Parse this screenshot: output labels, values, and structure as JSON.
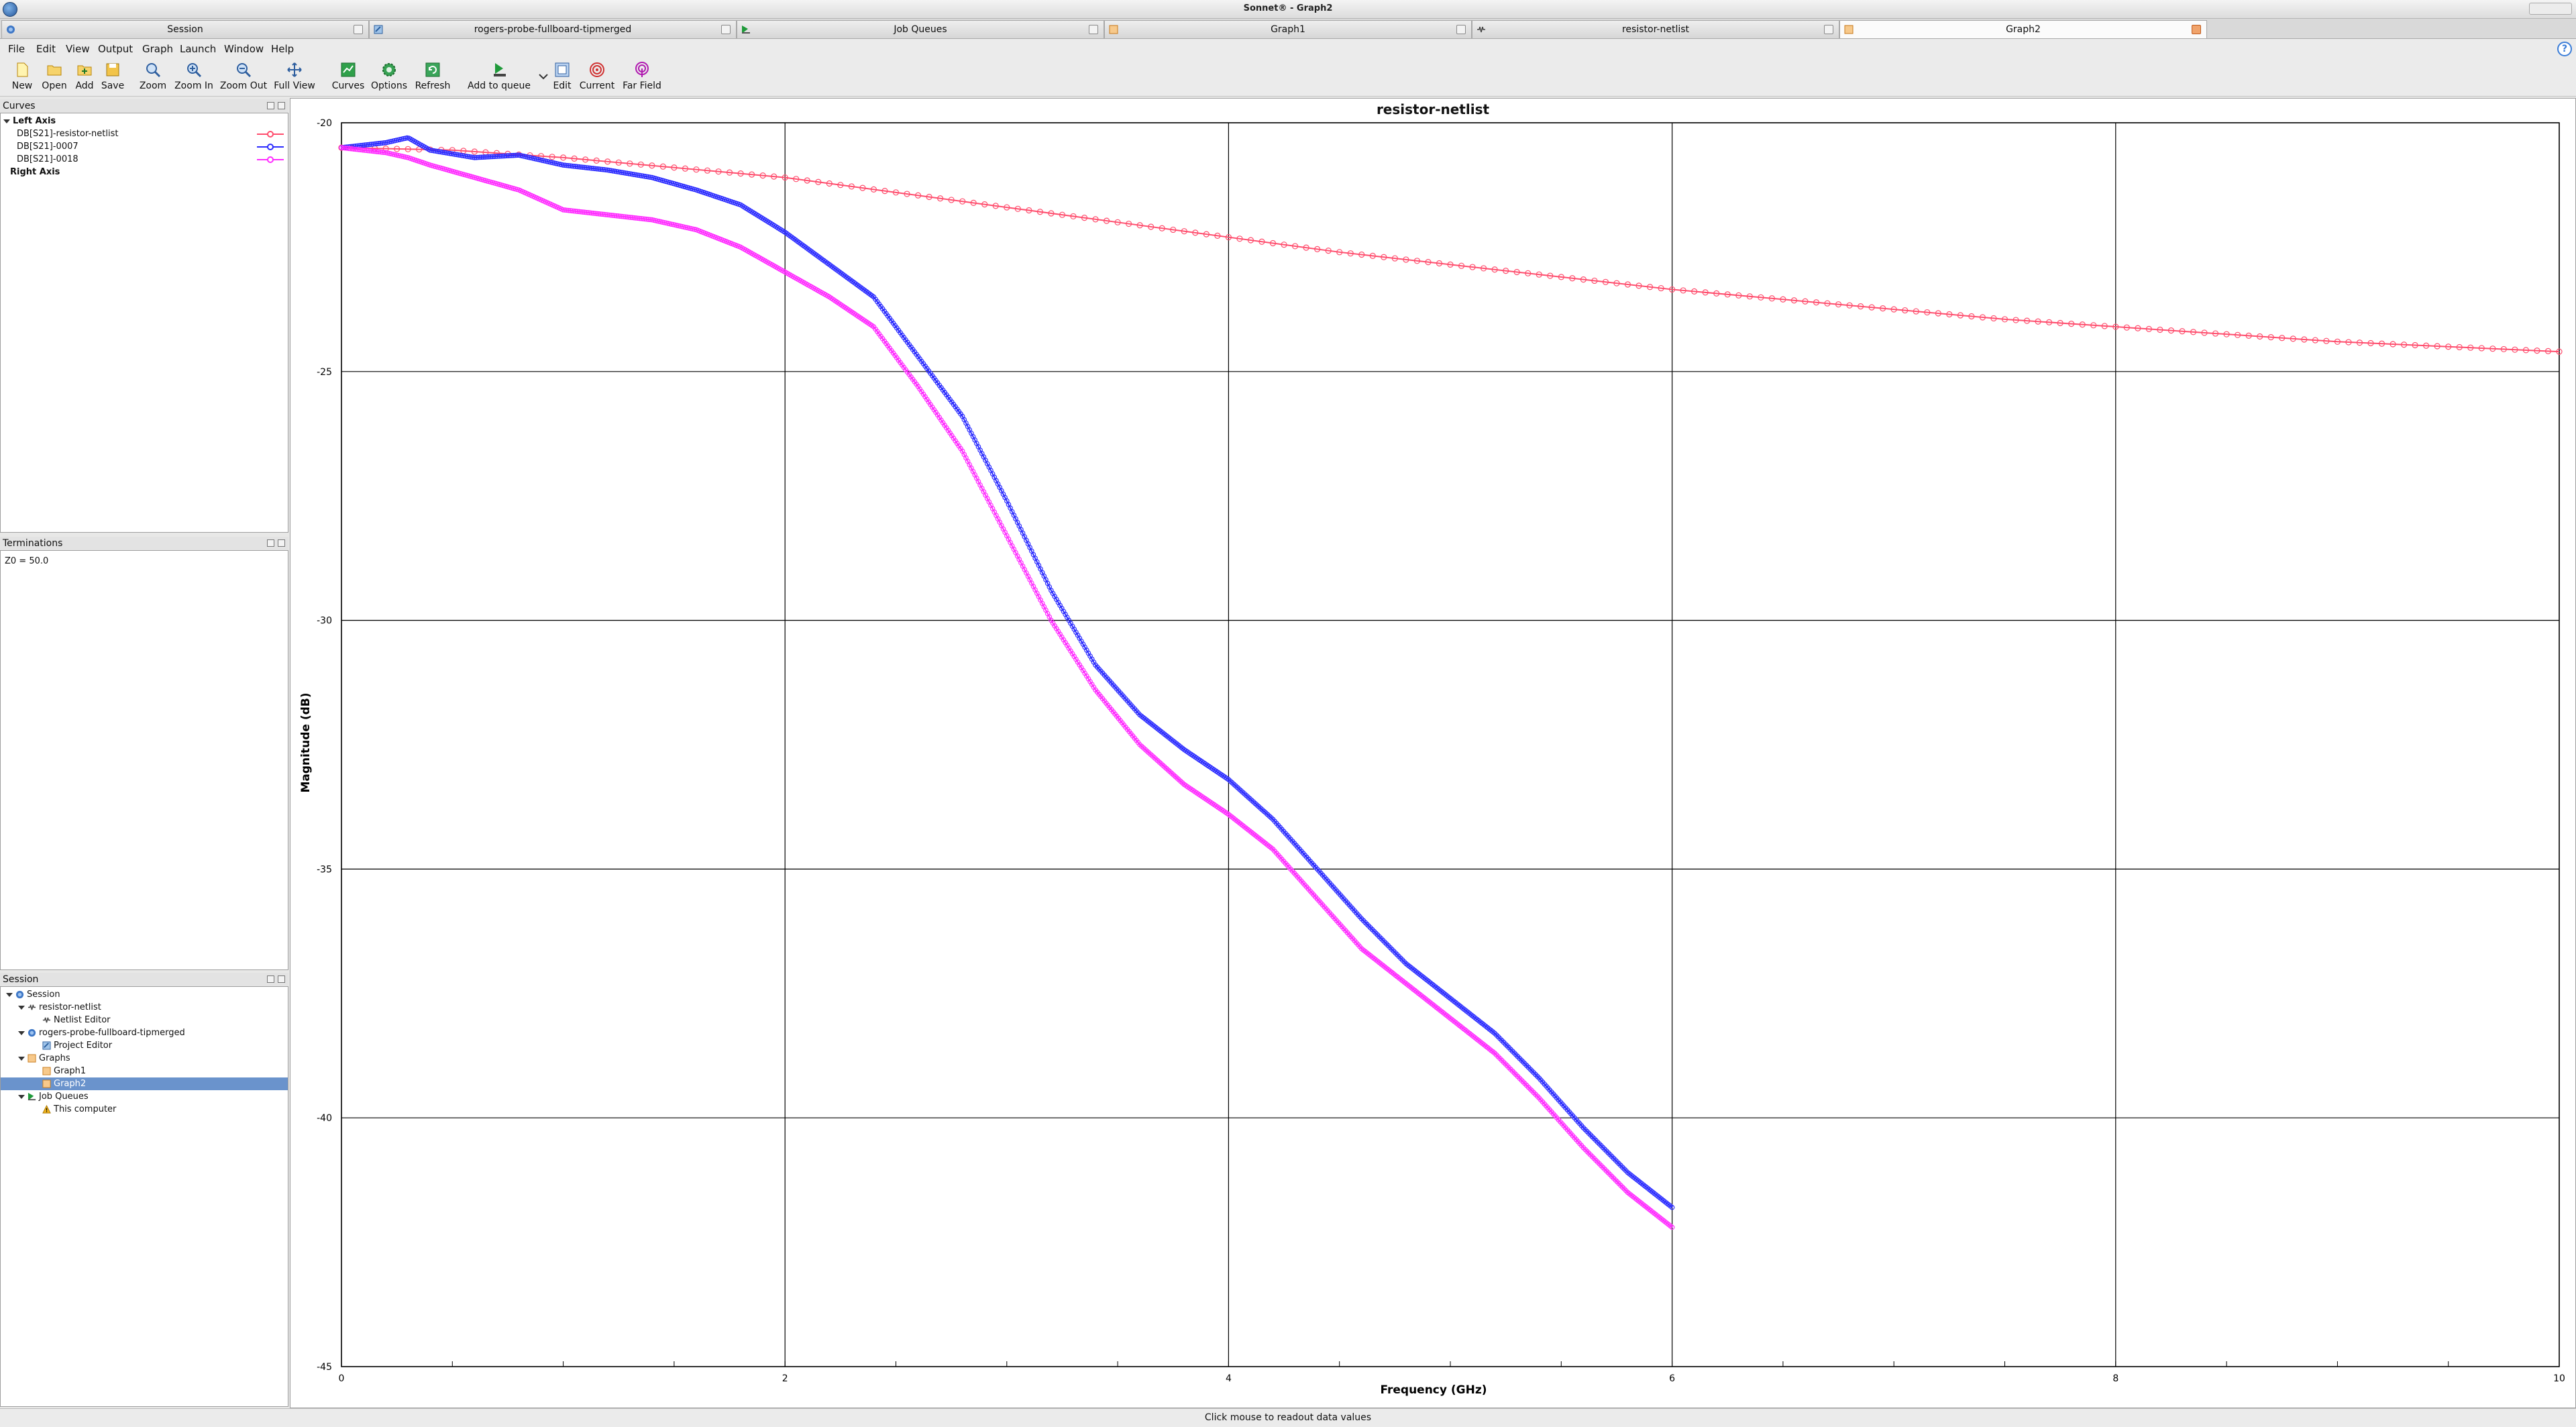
{
  "window": {
    "title": "Sonnet® - Graph2"
  },
  "doc_tabs": [
    {
      "label": "Session",
      "active": false
    },
    {
      "label": "rogers-probe-fullboard-tipmerged",
      "active": false
    },
    {
      "label": "Job Queues",
      "active": false
    },
    {
      "label": "Graph1",
      "active": false
    },
    {
      "label": "resistor-netlist",
      "active": false
    },
    {
      "label": "Graph2",
      "active": true
    }
  ],
  "menu": {
    "file": "File",
    "edit": "Edit",
    "view": "View",
    "output": "Output",
    "graph": "Graph",
    "launch": "Launch",
    "window": "Window",
    "help": "Help"
  },
  "toolbar": {
    "new": "New",
    "open": "Open",
    "add": "Add",
    "save": "Save",
    "zoom": "Zoom",
    "zoom_in": "Zoom In",
    "zoom_out": "Zoom Out",
    "full_view": "Full View",
    "curves": "Curves",
    "options": "Options",
    "refresh": "Refresh",
    "add_to_queue": "Add to queue",
    "edit": "Edit",
    "current": "Current",
    "far_field": "Far Field"
  },
  "curves_panel": {
    "title": "Curves",
    "left_axis": "Left Axis",
    "right_axis": "Right Axis",
    "items": [
      {
        "label": "DB[S21]-resistor-netlist",
        "color": "#ff4d6d"
      },
      {
        "label": "DB[S21]-0007",
        "color": "#2b2bff"
      },
      {
        "label": "DB[S21]-0018",
        "color": "#ff2bff"
      }
    ]
  },
  "terminations_panel": {
    "title": "Terminations",
    "text": "Z0 = 50.0"
  },
  "session_panel": {
    "title": "Session",
    "root": "Session",
    "resistor": "resistor-netlist",
    "netlist_editor": "Netlist Editor",
    "rogers": "rogers-probe-fullboard-tipmerged",
    "project_editor": "Project Editor",
    "graphs": "Graphs",
    "graph1": "Graph1",
    "graph2": "Graph2",
    "job_queues": "Job Queues",
    "this_computer": "This computer"
  },
  "status": {
    "text": "Click mouse to readout data values"
  },
  "chart_data": {
    "type": "line",
    "title": "resistor-netlist",
    "xlabel": "Frequency (GHz)",
    "ylabel": "Magnitude (dB)",
    "xlim": [
      0,
      10
    ],
    "ylim": [
      -45,
      -20
    ],
    "xticks": [
      0,
      2,
      4,
      6,
      8,
      10
    ],
    "yticks": [
      -20,
      -25,
      -30,
      -35,
      -40,
      -45
    ],
    "grid": true,
    "series": [
      {
        "name": "DB[S21]-resistor-netlist",
        "color": "#ff4d6d",
        "x": [
          0,
          0.5,
          1,
          1.5,
          2,
          2.5,
          3,
          3.5,
          4,
          4.5,
          5,
          5.5,
          6,
          6.5,
          7,
          7.5,
          8,
          8.5,
          9,
          9.5,
          10
        ],
        "y": [
          -20.5,
          -20.55,
          -20.7,
          -20.9,
          -21.1,
          -21.4,
          -21.7,
          -22.0,
          -22.3,
          -22.6,
          -22.85,
          -23.1,
          -23.35,
          -23.55,
          -23.75,
          -23.95,
          -24.1,
          -24.25,
          -24.4,
          -24.5,
          -24.6
        ]
      },
      {
        "name": "DB[S21]-0007",
        "color": "#2b2bff",
        "x": [
          0,
          0.1,
          0.2,
          0.3,
          0.4,
          0.6,
          0.8,
          1.0,
          1.2,
          1.4,
          1.6,
          1.8,
          2.0,
          2.2,
          2.4,
          2.6,
          2.8,
          3.0,
          3.2,
          3.4,
          3.6,
          3.8,
          4.0,
          4.2,
          4.4,
          4.6,
          4.8,
          5.0,
          5.2,
          5.4,
          5.6,
          5.8,
          6.0
        ],
        "y": [
          -20.5,
          -20.45,
          -20.4,
          -20.3,
          -20.55,
          -20.7,
          -20.65,
          -20.85,
          -20.95,
          -21.1,
          -21.35,
          -21.65,
          -22.2,
          -22.85,
          -23.5,
          -24.7,
          -25.9,
          -27.6,
          -29.4,
          -30.9,
          -31.9,
          -32.6,
          -33.2,
          -34.0,
          -35.0,
          -36.0,
          -36.9,
          -37.6,
          -38.3,
          -39.2,
          -40.2,
          -41.1,
          -41.8
        ]
      },
      {
        "name": "DB[S21]-0018",
        "color": "#ff2bff",
        "x": [
          0,
          0.1,
          0.2,
          0.3,
          0.4,
          0.6,
          0.8,
          1.0,
          1.2,
          1.4,
          1.6,
          1.8,
          2.0,
          2.2,
          2.4,
          2.6,
          2.8,
          3.0,
          3.2,
          3.4,
          3.6,
          3.8,
          4.0,
          4.2,
          4.4,
          4.6,
          4.8,
          5.0,
          5.2,
          5.4,
          5.6,
          5.8,
          6.0
        ],
        "y": [
          -20.5,
          -20.55,
          -20.6,
          -20.7,
          -20.85,
          -21.1,
          -21.35,
          -21.75,
          -21.85,
          -21.95,
          -22.15,
          -22.5,
          -23.0,
          -23.5,
          -24.1,
          -25.3,
          -26.6,
          -28.3,
          -30.0,
          -31.4,
          -32.5,
          -33.3,
          -33.9,
          -34.6,
          -35.6,
          -36.6,
          -37.3,
          -38.0,
          -38.7,
          -39.6,
          -40.6,
          -41.5,
          -42.2
        ]
      }
    ]
  }
}
